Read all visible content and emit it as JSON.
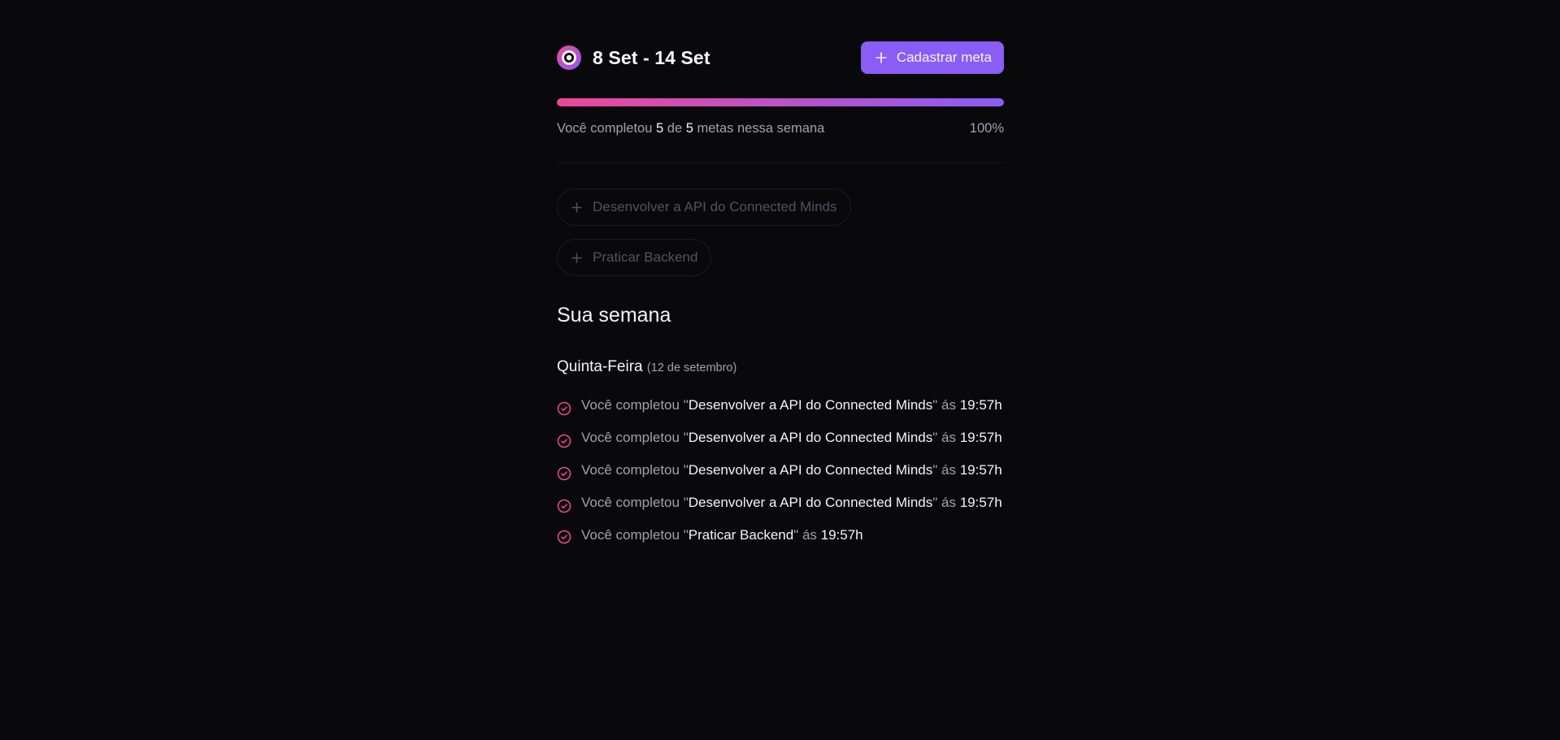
{
  "header": {
    "week_range": "8 Set - 14 Set",
    "add_button_label": "Cadastrar meta"
  },
  "progress": {
    "percent_value": 100,
    "text_prefix": "Você completou ",
    "completed": "5",
    "text_middle": " de ",
    "total": "5",
    "text_suffix": " metas nessa semana",
    "percent_label": "100%"
  },
  "pending_goals": [
    {
      "label": "Desenvolver a API do Connected Minds"
    },
    {
      "label": "Praticar Backend"
    }
  ],
  "summary": {
    "section_title": "Sua semana",
    "day": {
      "name": "Quinta-Feira",
      "date": "(12 de setembro)"
    },
    "activities": [
      {
        "prefix": "Você completou \"",
        "goal": "Desenvolver a API do Connected Minds",
        "middle": "\" ás ",
        "time": "19:57h"
      },
      {
        "prefix": "Você completou \"",
        "goal": "Desenvolver a API do Connected Minds",
        "middle": "\" ás ",
        "time": "19:57h"
      },
      {
        "prefix": "Você completou \"",
        "goal": "Desenvolver a API do Connected Minds",
        "middle": "\" ás ",
        "time": "19:57h"
      },
      {
        "prefix": "Você completou \"",
        "goal": "Desenvolver a API do Connected Minds",
        "middle": "\" ás ",
        "time": "19:57h"
      },
      {
        "prefix": "Você completou \"",
        "goal": "Praticar Backend",
        "middle": "\" ás ",
        "time": "19:57h"
      }
    ]
  },
  "icons": {
    "logo": "in-orbit-logo-icon",
    "add": "plus-icon",
    "check": "circle-check-icon"
  },
  "colors": {
    "background": "#09090b",
    "accent": "#8b5cf6",
    "pink": "#ec4899",
    "muted_text": "#a1a1aa"
  }
}
